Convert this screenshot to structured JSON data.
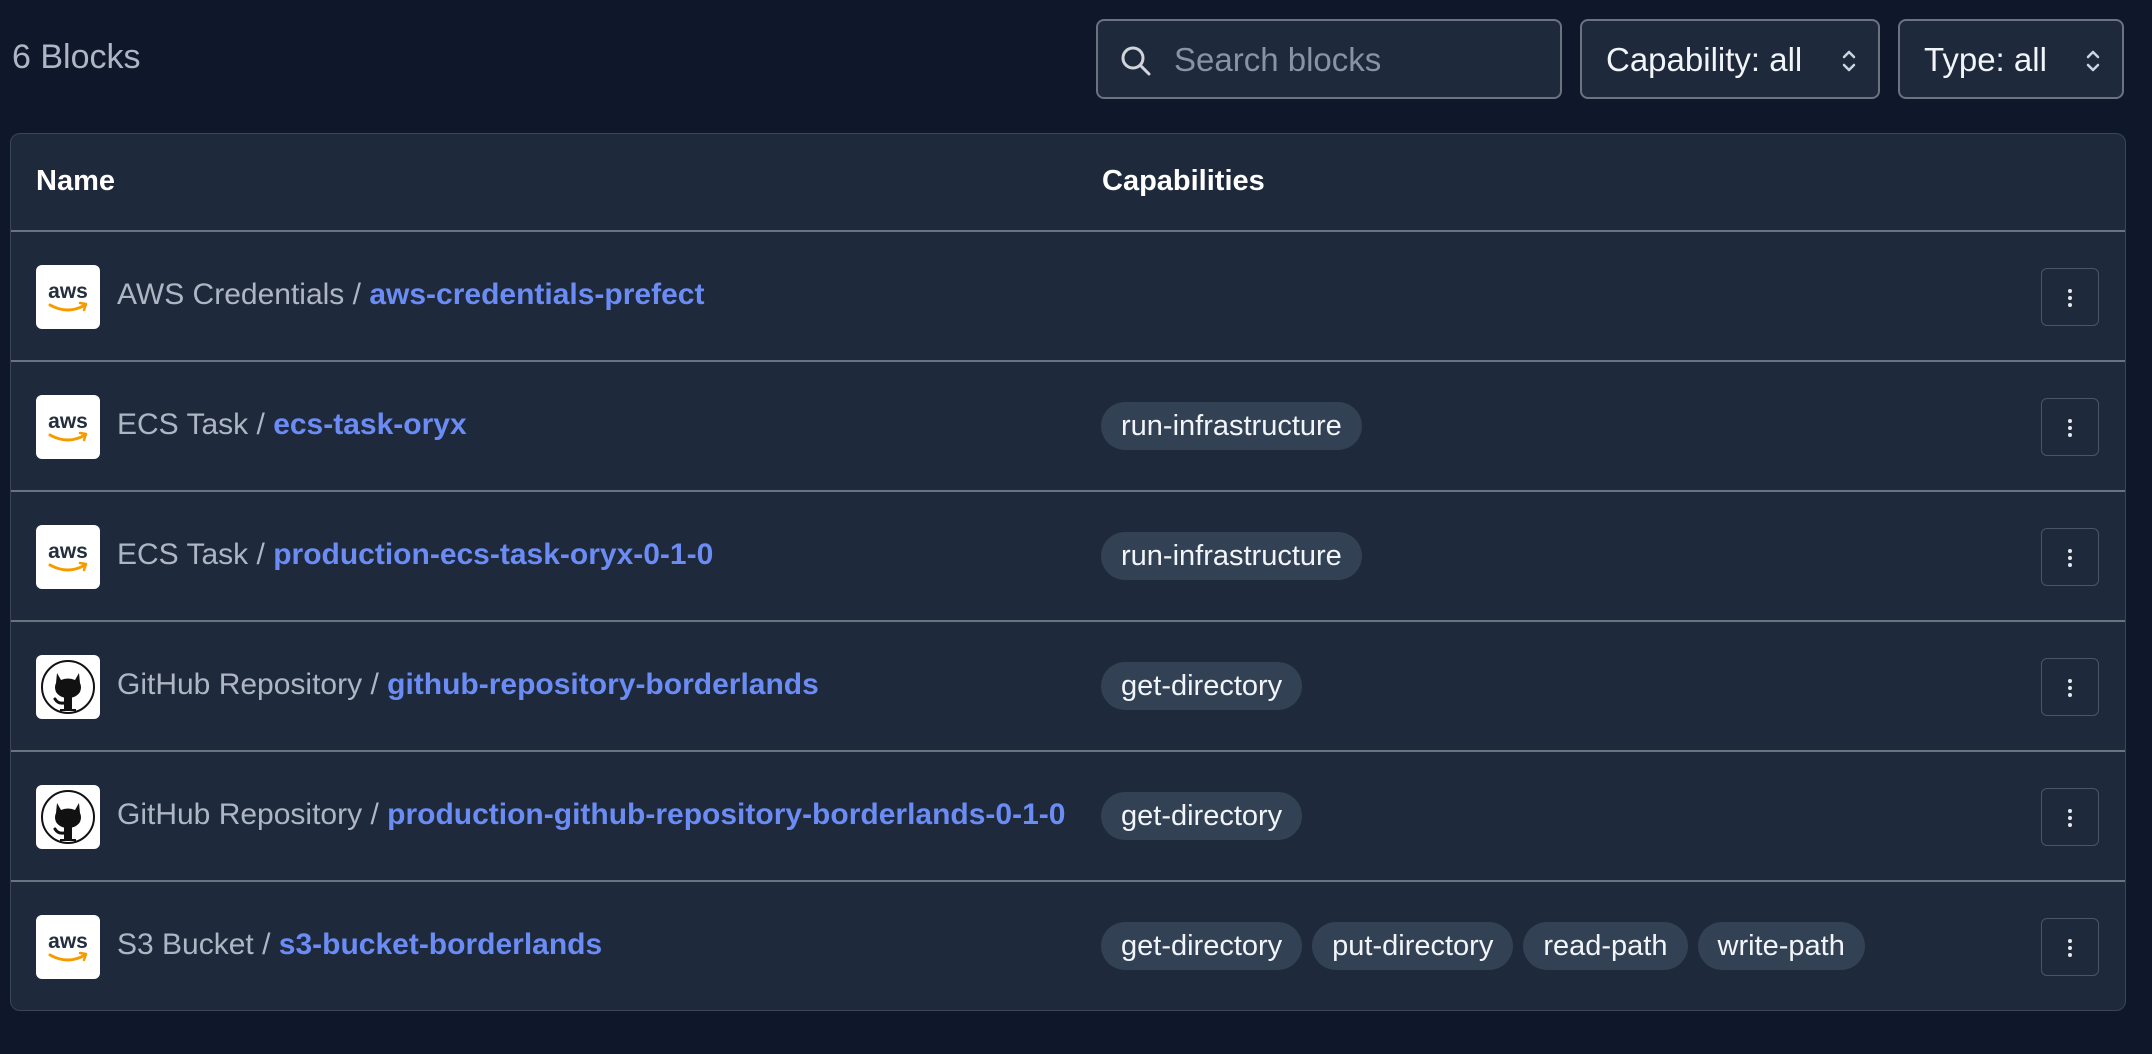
{
  "header": {
    "count_label": "6 Blocks",
    "search_placeholder": "Search blocks",
    "capability_filter": "Capability: all",
    "type_filter": "Type: all"
  },
  "table": {
    "columns": [
      "Name",
      "Capabilities"
    ],
    "rows": [
      {
        "logo": "aws-logo-icon",
        "block_type": "AWS Credentials",
        "separator": " / ",
        "block_name": "aws-credentials-prefect",
        "capabilities": []
      },
      {
        "logo": "aws-logo-icon",
        "block_type": "ECS Task",
        "separator": " / ",
        "block_name": "ecs-task-oryx",
        "capabilities": [
          "run-infrastructure"
        ]
      },
      {
        "logo": "aws-logo-icon",
        "block_type": "ECS Task",
        "separator": " / ",
        "block_name": "production-ecs-task-oryx-0-1-0",
        "capabilities": [
          "run-infrastructure"
        ]
      },
      {
        "logo": "github-logo-icon",
        "block_type": "GitHub Repository",
        "separator": " / ",
        "block_name": "github-repository-borderlands",
        "capabilities": [
          "get-directory"
        ]
      },
      {
        "logo": "github-logo-icon",
        "block_type": "GitHub Repository",
        "separator": " / ",
        "block_name": "production-github-repository-borderlands-0-1-0",
        "capabilities": [
          "get-directory"
        ]
      },
      {
        "logo": "aws-logo-icon",
        "block_type": "S3 Bucket",
        "separator": " / ",
        "block_name": "s3-bucket-borderlands",
        "capabilities": [
          "get-directory",
          "put-directory",
          "read-path",
          "write-path"
        ]
      }
    ]
  },
  "icons": {
    "search": "search-icon",
    "select": "chevron-up-down-icon",
    "row_menu": "kebab-menu-icon"
  },
  "colors": {
    "page_bg": "#0f172a",
    "panel_bg": "#1e293b",
    "link": "#6b8cf5",
    "tag_bg": "#334155",
    "aws_orange": "#f59b00"
  }
}
